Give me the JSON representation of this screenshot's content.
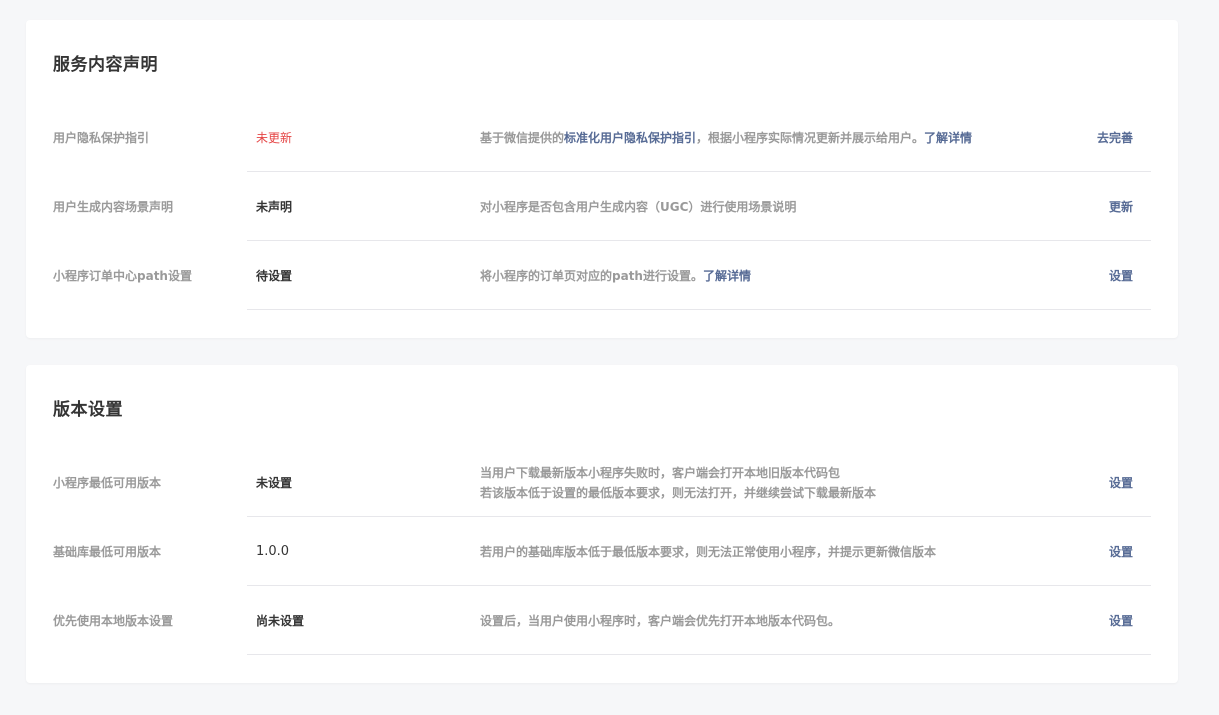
{
  "service_section": {
    "title": "服务内容声明",
    "rows": [
      {
        "label": "用户隐私保护指引",
        "status": "未更新",
        "desc_before": "基于微信提供的",
        "desc_link": "标准化用户隐私保护指引",
        "desc_after": "，根据小程序实际情况更新并展示给用户。",
        "desc_link2": "了解详情",
        "action": "去完善"
      },
      {
        "label": "用户生成内容场景声明",
        "status": "未声明",
        "desc": "对小程序是否包含用户生成内容（UGC）进行使用场景说明",
        "action": "更新"
      },
      {
        "label": "小程序订单中心path设置",
        "status": "待设置",
        "desc_before": "将小程序的订单页对应的path进行设置。",
        "desc_link": "了解详情",
        "action": "设置"
      }
    ]
  },
  "version_section": {
    "title": "版本设置",
    "rows": [
      {
        "label": "小程序最低可用版本",
        "status": "未设置",
        "desc_line1": "当用户下载最新版本小程序失败时，客户端会打开本地旧版本代码包",
        "desc_line2": "若该版本低于设置的最低版本要求，则无法打开，并继续尝试下载最新版本",
        "action": "设置"
      },
      {
        "label": "基础库最低可用版本",
        "status": "1.0.0",
        "desc": "若用户的基础库版本低于最低版本要求，则无法正常使用小程序，并提示更新微信版本",
        "action": "设置"
      },
      {
        "label": "优先使用本地版本设置",
        "status": "尚未设置",
        "desc": "设置后，当用户使用小程序时，客户端会优先打开本地版本代码包。",
        "action": "设置"
      }
    ]
  },
  "colors": {
    "link": "#576b95",
    "warning": "#e54545",
    "muted": "#9a9a9a",
    "text": "#353535",
    "background": "#f6f7f9"
  }
}
